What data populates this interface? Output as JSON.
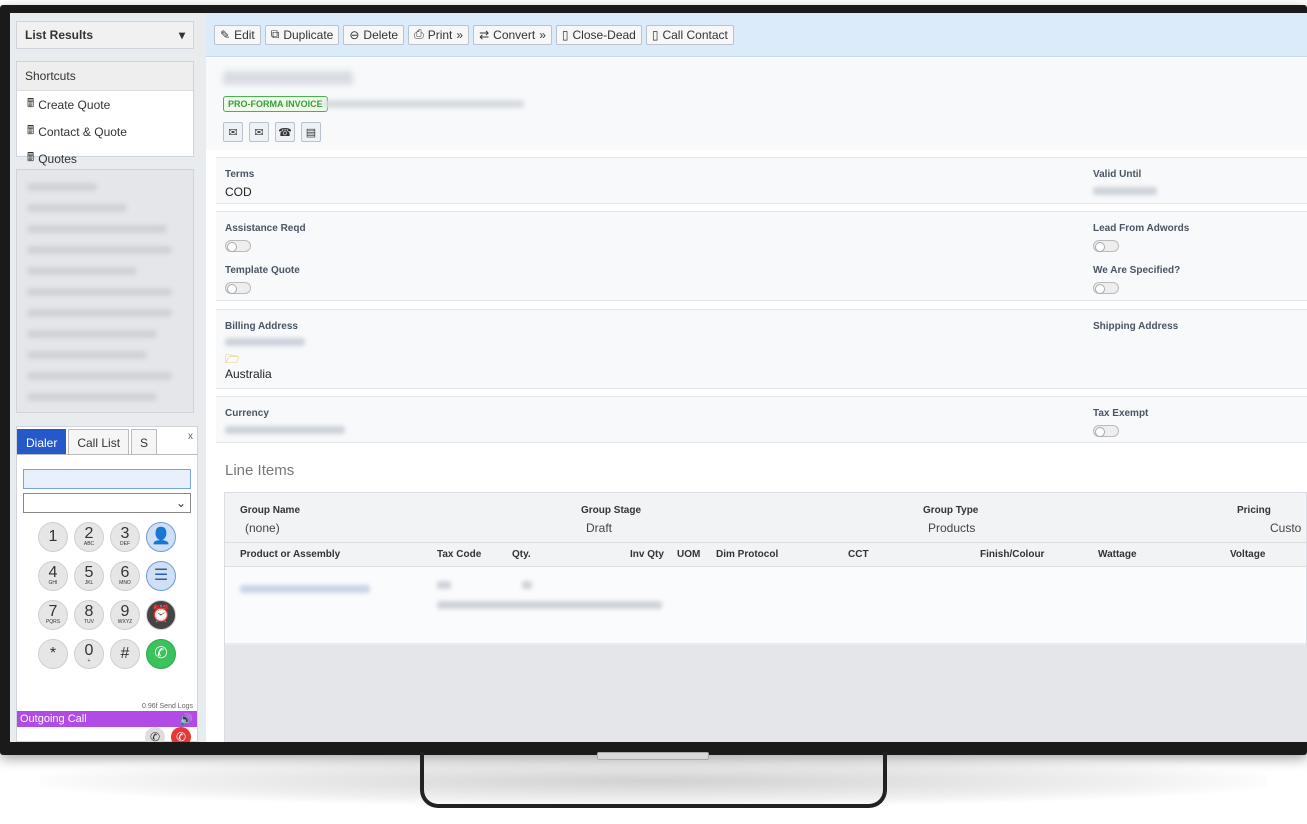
{
  "sidebar": {
    "list_results": "List Results",
    "shortcuts_title": "Shortcuts",
    "shortcuts": [
      "Create Quote",
      "Contact & Quote",
      "Quotes"
    ]
  },
  "dialer": {
    "tabs": [
      "Dialer",
      "Call List",
      "S"
    ],
    "close": "x",
    "keys": [
      {
        "digit": "1",
        "letters": ""
      },
      {
        "digit": "2",
        "letters": "ABC"
      },
      {
        "digit": "3",
        "letters": "DEF"
      },
      {
        "digit": "4",
        "letters": "GHI"
      },
      {
        "digit": "5",
        "letters": "JKL"
      },
      {
        "digit": "6",
        "letters": "MNO"
      },
      {
        "digit": "7",
        "letters": "PQRS"
      },
      {
        "digit": "8",
        "letters": "TUV"
      },
      {
        "digit": "9",
        "letters": "WXYZ"
      },
      {
        "digit": "*",
        "letters": ""
      },
      {
        "digit": "0",
        "letters": "+"
      },
      {
        "digit": "#",
        "letters": ""
      }
    ],
    "version": "0.96f Send Logs",
    "outgoing": "Outgoing Call"
  },
  "toolbar": {
    "edit": "Edit",
    "duplicate": "Duplicate",
    "delete": "Delete",
    "print": "Print",
    "convert": "Convert",
    "close_dead": "Close-Dead",
    "call_contact": "Call Contact"
  },
  "record": {
    "badge": "PRO-FORMA INVOICE"
  },
  "details": {
    "terms_label": "Terms",
    "terms_value": "COD",
    "valid_until_label": "Valid Until",
    "assistance_label": "Assistance Reqd",
    "lead_adwords_label": "Lead From Adwords",
    "template_quote_label": "Template Quote",
    "we_are_specified_label": "We Are Specified?",
    "billing_label": "Billing Address",
    "shipping_label": "Shipping Address",
    "billing_country": "Australia",
    "currency_label": "Currency",
    "tax_exempt_label": "Tax Exempt"
  },
  "line_items": {
    "title": "Line Items",
    "group_name_label": "Group Name",
    "group_name_value": "(none)",
    "group_stage_label": "Group Stage",
    "group_stage_value": "Draft",
    "group_type_label": "Group Type",
    "group_type_value": "Products",
    "pricing_label": "Pricing",
    "pricing_value": "Custo",
    "columns": [
      "Product or Assembly",
      "Tax Code",
      "Qty.",
      "Inv Qty",
      "UOM",
      "Dim Protocol",
      "CCT",
      "Finish/Colour",
      "Wattage",
      "Voltage"
    ]
  }
}
